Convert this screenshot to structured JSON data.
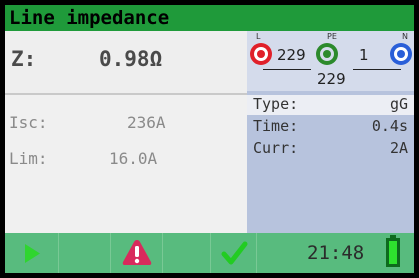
{
  "title": "Line impedance",
  "result": {
    "z_label": "Z:",
    "z_value": "0.98Ω"
  },
  "measurements": [
    {
      "label": "Isc:",
      "value": "236A"
    },
    {
      "label": "Lim:",
      "value": "16.0A"
    }
  ],
  "terminals": {
    "l_label": "L",
    "pe_label": "PE",
    "n_label": "N",
    "l_pe_value": "229",
    "pe_n_value": "1",
    "l_n_value": "229",
    "colors": {
      "l": "#e0202a",
      "pe": "#2c8a2c",
      "n": "#2a5fd8"
    }
  },
  "settings": [
    {
      "label": "Type:",
      "value": "gG"
    },
    {
      "label": "Time:",
      "value": "0.4s"
    },
    {
      "label": "Curr:",
      "value": "2A"
    }
  ],
  "toolbar": {
    "start_icon": "play-icon",
    "warning_icon": "warning-icon",
    "pass_icon": "check-icon",
    "battery_icon": "battery-icon",
    "clock": "21:48"
  },
  "colors": {
    "title_bg": "#1f9a3a",
    "toolbar_bg": "#58bb7e",
    "settings_bg": "#b7c3dd"
  }
}
